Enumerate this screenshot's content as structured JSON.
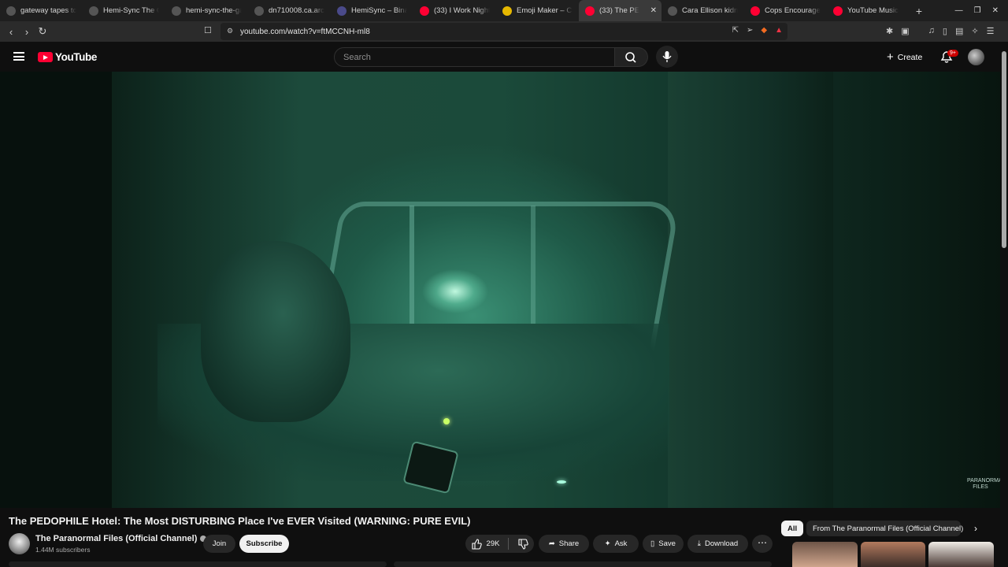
{
  "tabs": [
    {
      "title": "gateway tapes to",
      "color": "#555555"
    },
    {
      "title": "Hemi-Sync The G",
      "color": "#555555"
    },
    {
      "title": "hemi-sync-the-ga",
      "color": "#555555"
    },
    {
      "title": "dn710008.ca.arch",
      "color": "#555555"
    },
    {
      "title": "HemiSync – Binau",
      "color": "#4a4a8a"
    },
    {
      "title": "(33) I Work Nights",
      "color": "#ff0033"
    },
    {
      "title": "Emoji Maker – Cre",
      "color": "#e6b800"
    },
    {
      "title": "(33) The PE",
      "color": "#ff0033",
      "active": true
    },
    {
      "title": "Cara Ellison kidna",
      "color": "#555555"
    },
    {
      "title": "Cops Encouraged",
      "color": "#ff0033"
    },
    {
      "title": "YouTube Music",
      "color": "#ff0033"
    }
  ],
  "address": {
    "url": "youtube.com/watch?v=ftMCCNH-ml8"
  },
  "header": {
    "search_placeholder": "Search",
    "create_label": "Create",
    "notif_badge": "9+"
  },
  "video": {
    "title": "The PEDOPHILE Hotel: The Most DISTURBING Place I've EVER Visited (WARNING: PURE EVIL)",
    "watermark": "PARANORMAL FILES"
  },
  "channel": {
    "name": "The Paranormal Files (Official Channel)",
    "subscribers": "1.44M subscribers",
    "join_label": "Join",
    "subscribe_label": "Subscribe"
  },
  "actions": {
    "likes": "29K",
    "share": "Share",
    "ask": "Ask",
    "save": "Save",
    "download": "Download"
  },
  "chips": {
    "all": "All",
    "from_channel": "From The Paranormal Files (Official Channel)"
  },
  "colors": {
    "yt_red": "#ff0033",
    "bg": "#0f0f0f",
    "pill": "#272727",
    "night_vision": "#1f5a48"
  }
}
